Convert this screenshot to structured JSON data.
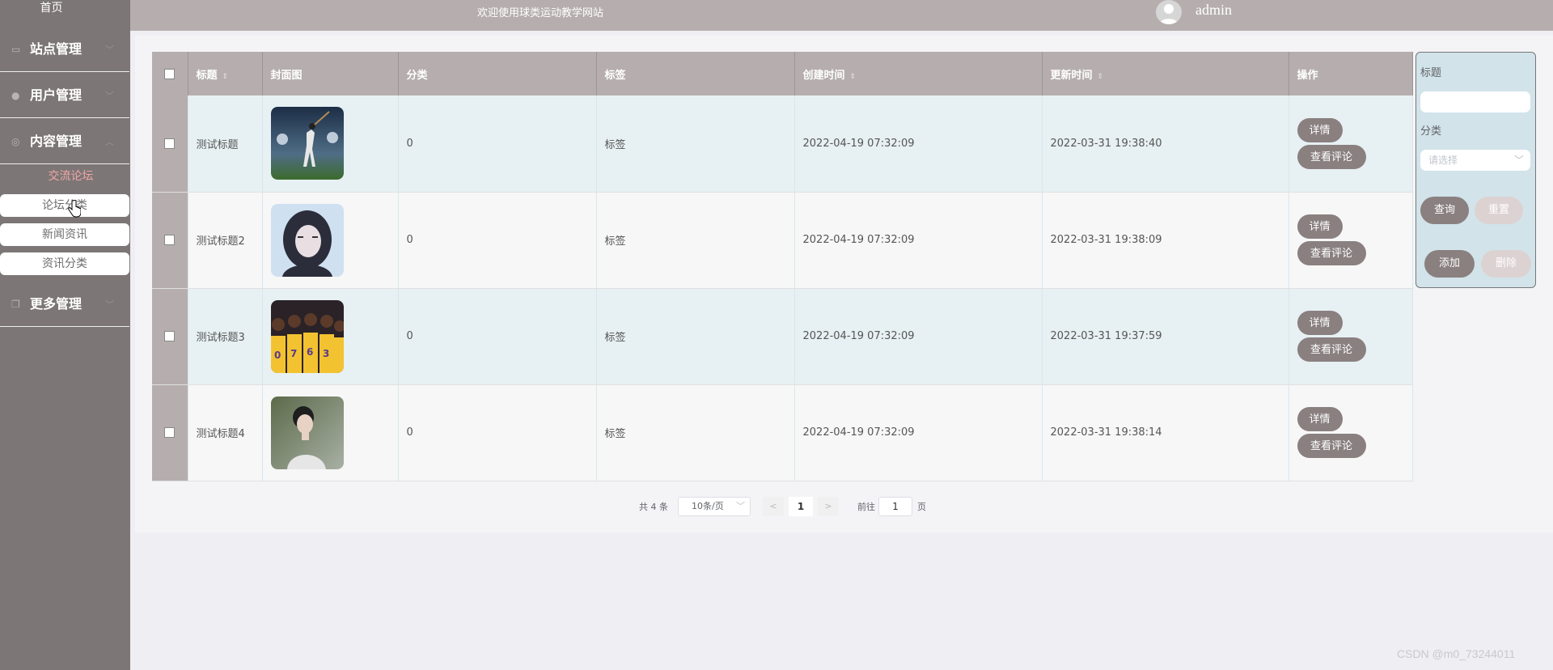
{
  "sidebar": {
    "home": "首页",
    "menus": [
      {
        "label": "站点管理",
        "icon": "chat-icon",
        "arrow": "﹀"
      },
      {
        "label": "用户管理",
        "icon": "user-icon",
        "arrow": "﹀"
      },
      {
        "label": "内容管理",
        "icon": "content-icon",
        "arrow": "︿"
      },
      {
        "label": "更多管理",
        "icon": "copy-icon",
        "arrow": "﹀"
      }
    ],
    "submenu_title": "交流论坛",
    "submenu_items": [
      "论坛分类",
      "新闻资讯",
      "资讯分类"
    ]
  },
  "header": {
    "welcome": "欢迎使用球类运动教学网站",
    "username": "admin"
  },
  "table": {
    "columns": [
      "标题",
      "封面图",
      "分类",
      "标签",
      "创建时间",
      "更新时间",
      "操作"
    ],
    "sort_icon": "⇕",
    "rows": [
      {
        "title": "测试标题",
        "category": "0",
        "tag": "标签",
        "created": "2022-04-19 07:32:09",
        "updated": "2022-03-31 19:38:40"
      },
      {
        "title": "测试标题2",
        "category": "0",
        "tag": "标签",
        "created": "2022-04-19 07:32:09",
        "updated": "2022-03-31 19:38:09"
      },
      {
        "title": "测试标题3",
        "category": "0",
        "tag": "标签",
        "created": "2022-04-19 07:32:09",
        "updated": "2022-03-31 19:37:59"
      },
      {
        "title": "测试标题4",
        "category": "0",
        "tag": "标签",
        "created": "2022-04-19 07:32:09",
        "updated": "2022-03-31 19:38:14"
      }
    ],
    "actions": {
      "detail": "详情",
      "comments": "查看评论"
    }
  },
  "pagination": {
    "total": "共 4 条",
    "page_size": "10条/页",
    "prev": "<",
    "current": "1",
    "next": ">",
    "goto_label": "前往",
    "goto_value": "1",
    "page_suffix": "页",
    "dropdown": "﹀"
  },
  "search": {
    "title_label": "标题",
    "title_value": "",
    "category_label": "分类",
    "category_placeholder": "请选择",
    "dropdown": "﹀",
    "query": "查询",
    "reset": "重置",
    "add": "添加",
    "delete": "删除"
  },
  "watermark": "CSDN @m0_73244011",
  "colors": {
    "sidebar": "#7d7676",
    "topbar": "#b6aeae",
    "accent_button": "#8a8080",
    "submenu_active": "#f0a6a6",
    "row_highlight": "#e7f0f3",
    "panel": "#d2e3ea"
  }
}
